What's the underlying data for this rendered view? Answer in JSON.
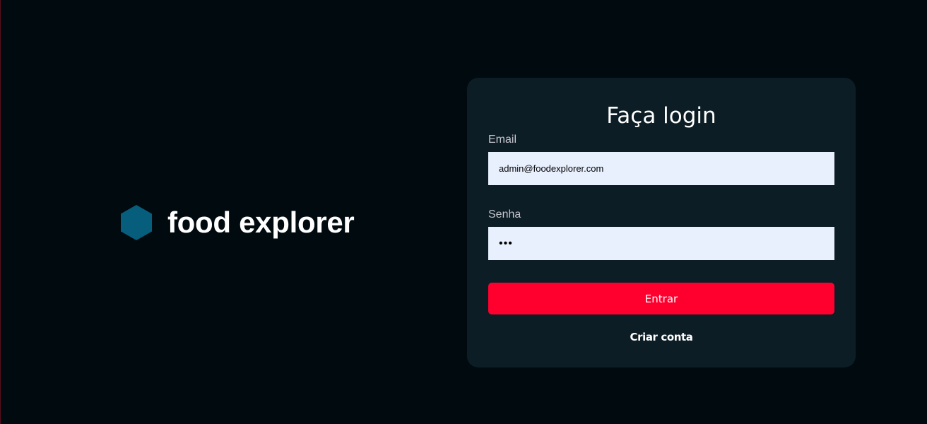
{
  "brand": {
    "name": "food explorer",
    "logo_icon": "hexagon-icon",
    "logo_color": "#065e7c"
  },
  "login": {
    "title": "Faça login",
    "email_label": "Email",
    "email_value": "admin@foodexplorer.com",
    "password_label": "Senha",
    "password_value": "•••",
    "submit_label": "Entrar",
    "create_account_label": "Criar conta"
  },
  "colors": {
    "background": "#000a0f",
    "card": "#0d1d25",
    "accent": "#ff002e",
    "input_background": "#e8f0fe"
  }
}
